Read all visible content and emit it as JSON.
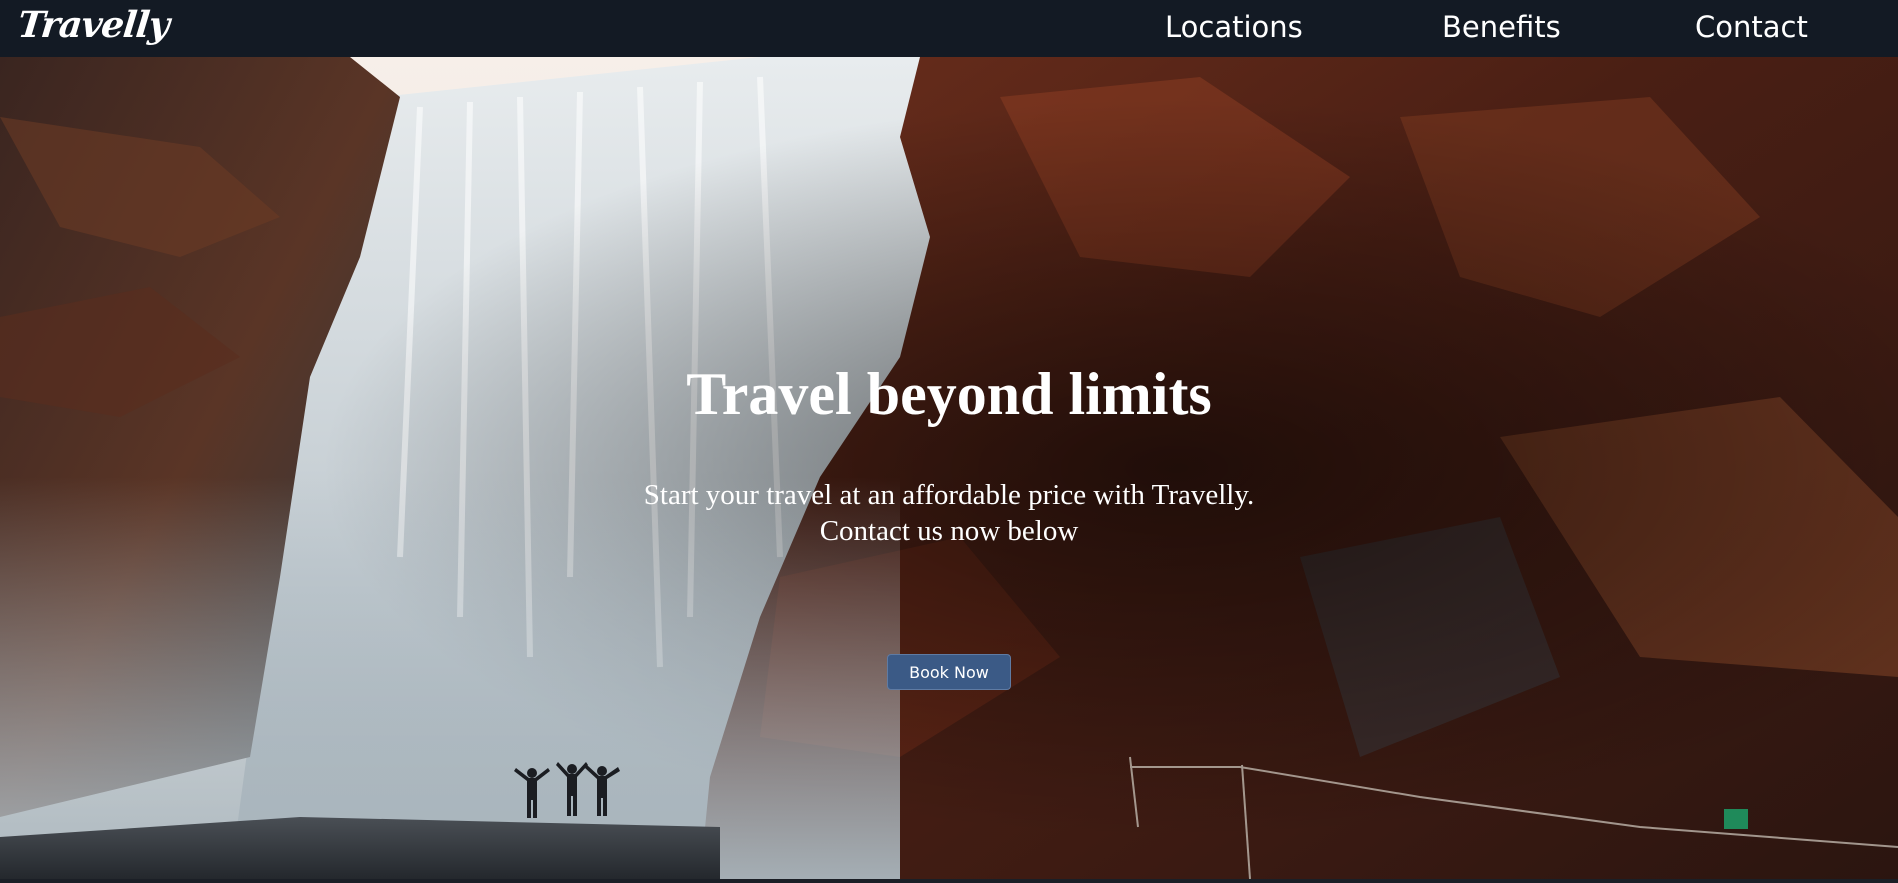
{
  "brand": {
    "logo_text": "Travelly"
  },
  "nav": {
    "items": [
      {
        "label": "Locations"
      },
      {
        "label": "Benefits"
      },
      {
        "label": "Contact"
      }
    ]
  },
  "hero": {
    "title": "Travel beyond limits",
    "subtitle_line1": "Start your travel at an affordable price with Travelly.",
    "subtitle_line2": "Contact us now below",
    "cta_label": "Book Now",
    "image_description_icon": "waterfall-landscape-image"
  },
  "colors": {
    "navbar_bg": "#131a24",
    "button_bg": "#3b5a86",
    "text": "#ffffff"
  }
}
